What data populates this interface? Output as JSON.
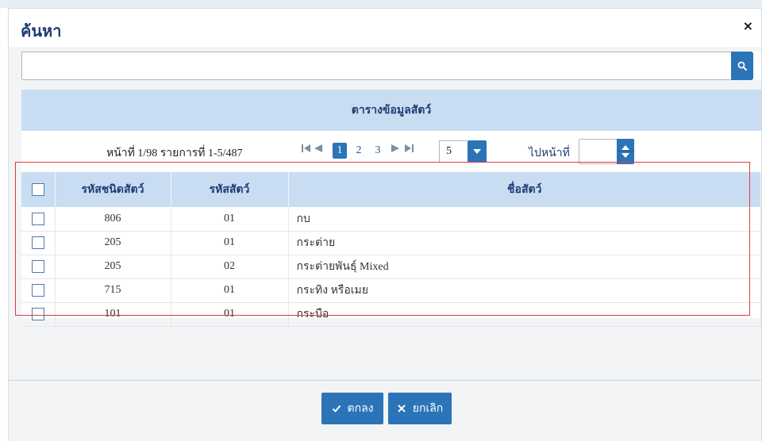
{
  "modal": {
    "title": "ค้นหา",
    "close_label": "×"
  },
  "search": {
    "value": "",
    "placeholder": ""
  },
  "panel": {
    "title": "ตารางข้อมูลสัตว์"
  },
  "pager": {
    "info": "หน้าที่ 1/98 รายการที่ 1-5/487",
    "pages": [
      "1",
      "2",
      "3"
    ],
    "active_page": "1",
    "page_size": "5",
    "goto_label": "ไปหน้าที่",
    "goto_value": ""
  },
  "table": {
    "headers": [
      "รหัสชนิดสัตว์",
      "รหัสสัตว์",
      "ชื่อสัตว์"
    ],
    "rows": [
      {
        "type_code": "806",
        "animal_code": "01",
        "name": "กบ"
      },
      {
        "type_code": "205",
        "animal_code": "01",
        "name": "กระต่าย"
      },
      {
        "type_code": "205",
        "animal_code": "02",
        "name": "กระต่ายพันธุ์ Mixed"
      },
      {
        "type_code": "715",
        "animal_code": "01",
        "name": "กระทิง หรือเมย"
      },
      {
        "type_code": "101",
        "animal_code": "01",
        "name": "กระบือ"
      }
    ]
  },
  "footer": {
    "ok_label": "ตกลง",
    "cancel_label": "ยกเลิก"
  },
  "colors": {
    "primary": "#2b74b8",
    "header_bg": "#c9ddf2",
    "highlight_border": "#e03b3b"
  },
  "icons": {
    "search": "search-icon",
    "close": "close-icon",
    "first": "first-page-icon",
    "prev": "prev-page-icon",
    "next": "next-page-icon",
    "last": "last-page-icon",
    "dropdown": "chevron-down-icon",
    "spinner": "spinner-icon",
    "check": "check-icon",
    "times": "times-icon"
  }
}
